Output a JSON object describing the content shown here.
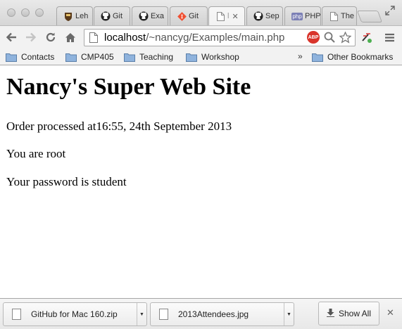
{
  "tabs": [
    {
      "label": "Leh",
      "icon": "lehigh-shield-icon"
    },
    {
      "label": "Git",
      "icon": "github-octocat-icon"
    },
    {
      "label": "Exa",
      "icon": "github-octocat-icon"
    },
    {
      "label": "Git",
      "icon": "git-logo-icon"
    },
    {
      "label": "l",
      "icon": "blank-page-icon",
      "active": true
    },
    {
      "label": "Sep",
      "icon": "github-octocat-icon"
    },
    {
      "label": "PHP",
      "icon": "php-logo-icon"
    },
    {
      "label": "The",
      "icon": "blank-page-icon"
    }
  ],
  "php_badge": "php",
  "address_bar": {
    "host": "localhost",
    "path": "/~nancyg/Examples/main.php"
  },
  "abp_label": "ABP",
  "bookmarks": {
    "items": [
      "Contacts",
      "CMP405",
      "Teaching",
      "Workshop"
    ],
    "overflow": "»",
    "other": "Other Bookmarks"
  },
  "page": {
    "title": "Nancy's Super Web Site",
    "line1": "Order processed at16:55, 24th September 2013",
    "line2": "You are root",
    "line3": "Your password is student"
  },
  "downloads": {
    "items": [
      {
        "name": "GitHub for Mac 160.zip"
      },
      {
        "name": "2013Attendees.jpg"
      }
    ],
    "show_all": "Show All"
  },
  "colors": {
    "abp": "#d9342b",
    "chrome_bg": "#f2f2f2",
    "folder": "#6f9fd4"
  }
}
